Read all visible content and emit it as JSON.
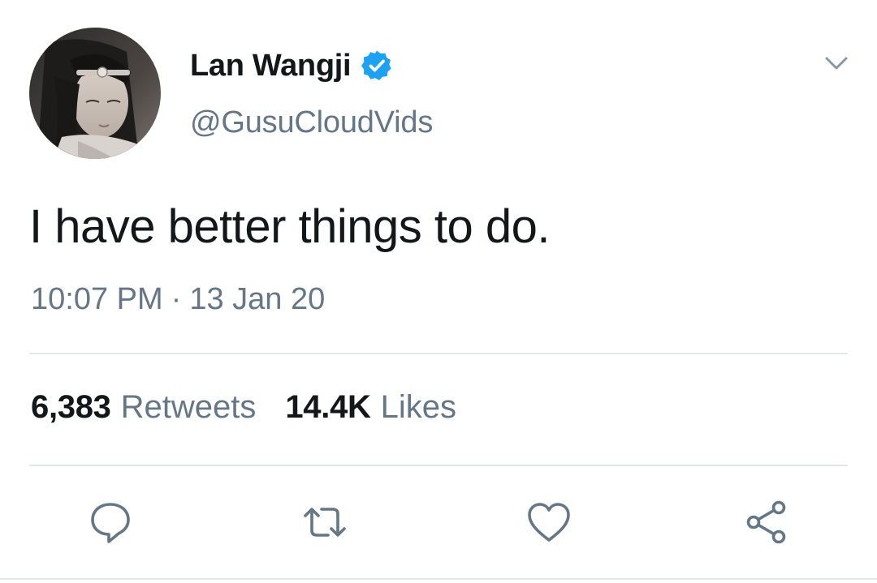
{
  "tweet": {
    "author": {
      "display_name": "Lan Wangji",
      "handle": "@GusuCloudVids",
      "verified": true,
      "verified_icon": "verified-badge-icon",
      "verified_color": "#1da1f2"
    },
    "text": "I have better things to do.",
    "time": "10:07 PM",
    "separator": "·",
    "date": "13 Jan 20",
    "stats": {
      "retweets_count": "6,383",
      "retweets_label": "Retweets",
      "likes_count": "14.4K",
      "likes_label": "Likes"
    },
    "actions": [
      {
        "name": "reply",
        "icon": "reply-icon"
      },
      {
        "name": "retweet",
        "icon": "retweet-icon"
      },
      {
        "name": "like",
        "icon": "heart-icon"
      },
      {
        "name": "share",
        "icon": "share-icon"
      }
    ],
    "menu_icon": "chevron-down-icon"
  },
  "colors": {
    "text_primary": "#14171a",
    "text_secondary": "#657786",
    "divider": "#e1e8ed",
    "accent": "#1da1f2"
  }
}
